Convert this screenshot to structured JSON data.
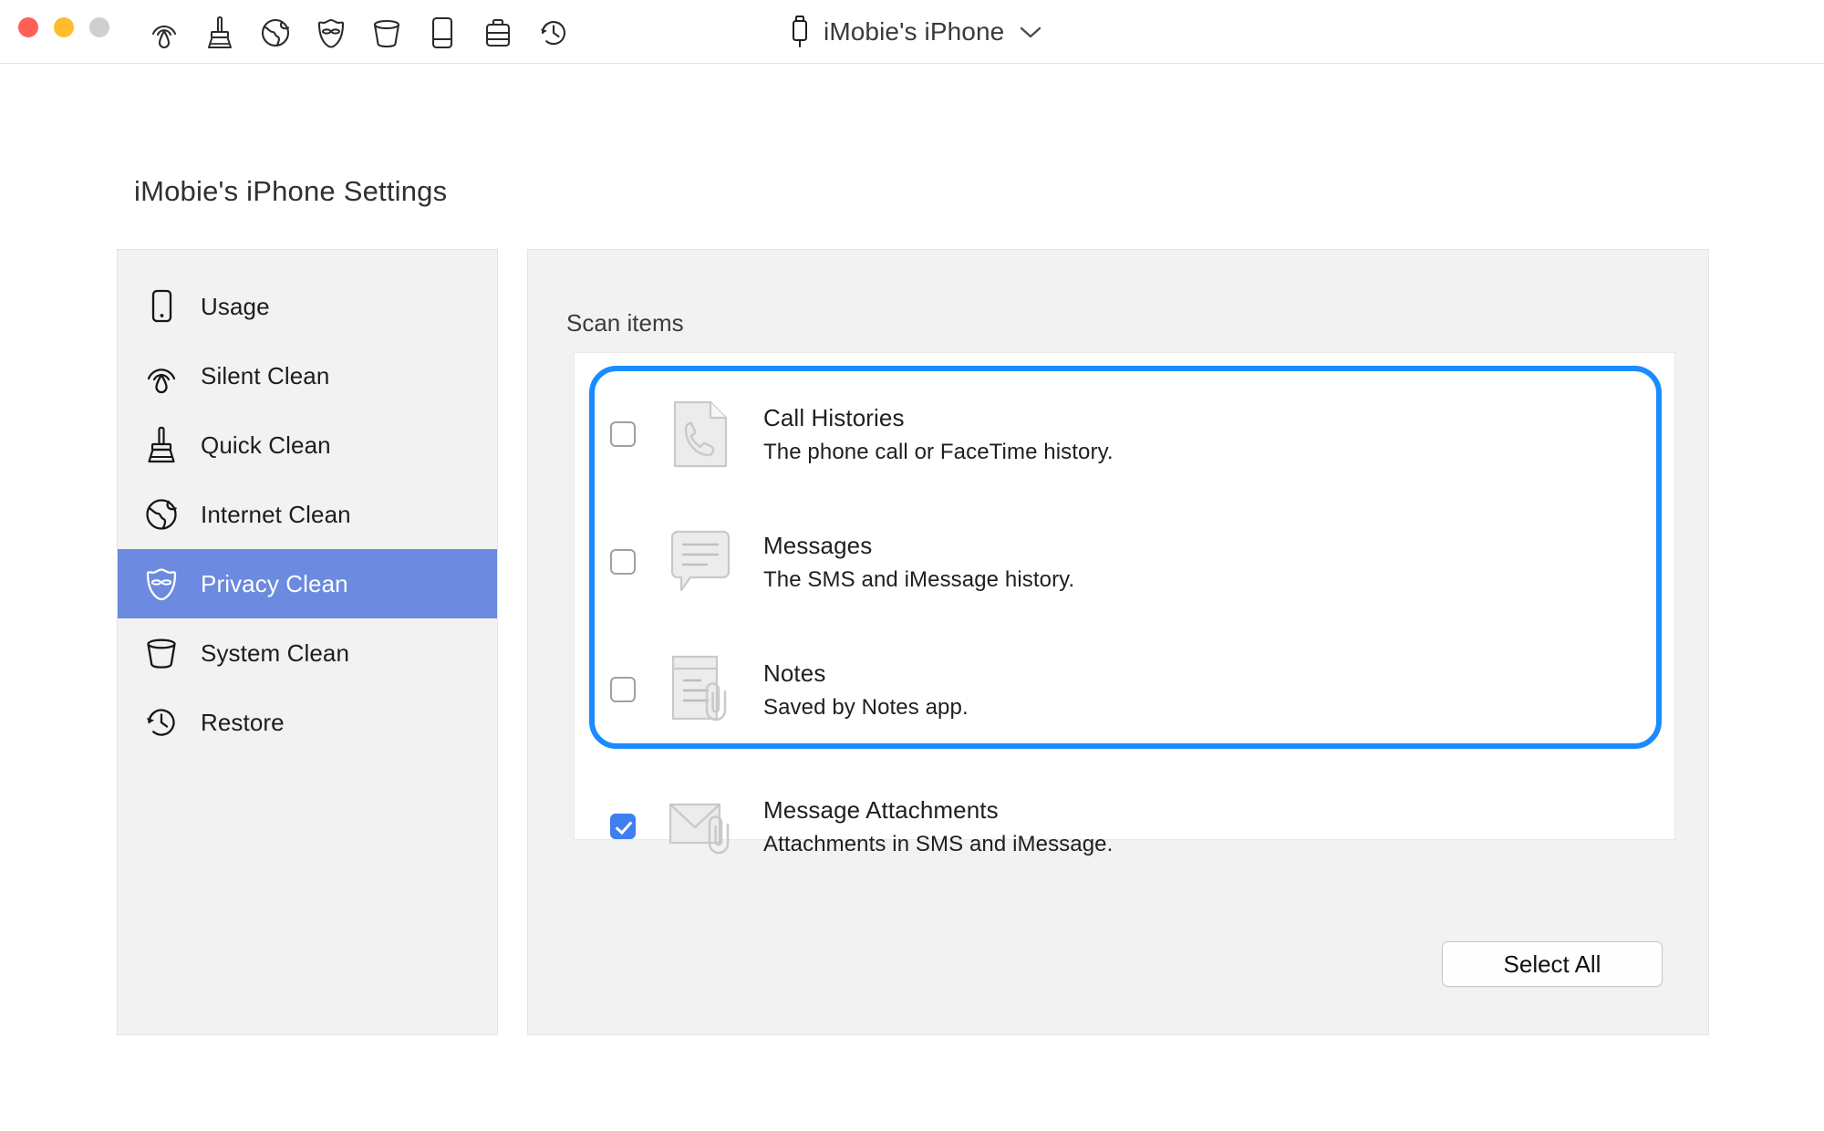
{
  "window": {
    "traffic_lights": [
      {
        "name": "close",
        "color": "#ff5f57"
      },
      {
        "name": "minimize",
        "color": "#febc2e"
      },
      {
        "name": "zoom",
        "color": "#cfcfcf"
      }
    ],
    "toolbar_icons": [
      "silent-clean-icon",
      "quick-clean-icon",
      "internet-clean-icon",
      "privacy-clean-icon",
      "system-clean-icon",
      "usage-icon",
      "toolbox-icon",
      "restore-icon"
    ],
    "device_name": "iMobie's iPhone",
    "device_chevron": "chevron-down-icon"
  },
  "page": {
    "title": "iMobie's iPhone Settings"
  },
  "sidebar": {
    "items": [
      {
        "label": "Usage",
        "icon": "phone-outline-icon",
        "active": false
      },
      {
        "label": "Silent Clean",
        "icon": "silent-clean-icon",
        "active": false
      },
      {
        "label": "Quick Clean",
        "icon": "quick-clean-icon",
        "active": false
      },
      {
        "label": "Internet Clean",
        "icon": "globe-icon",
        "active": false
      },
      {
        "label": "Privacy Clean",
        "icon": "mask-icon",
        "active": true
      },
      {
        "label": "System Clean",
        "icon": "trash-bin-icon",
        "active": false
      },
      {
        "label": "Restore",
        "icon": "clock-restore-icon",
        "active": false
      }
    ],
    "active_color": "#6b8ae0"
  },
  "main": {
    "section_title": "Scan items",
    "focus_ring_color": "#1a8cff",
    "checkbox_checked_color": "#3d7ef0",
    "rows": [
      {
        "title": "Call Histories",
        "description": "The phone call or FaceTime history.",
        "icon": "call-history-document-icon",
        "checked": false,
        "focused": true
      },
      {
        "title": "Messages",
        "description": "The SMS and iMessage history.",
        "icon": "message-bubble-icon",
        "checked": false,
        "focused": true
      },
      {
        "title": "Notes",
        "description": "Saved by Notes app.",
        "icon": "notes-paperclip-icon",
        "checked": false,
        "focused": true
      },
      {
        "title": "Message Attachments",
        "description": "Attachments in SMS and iMessage.",
        "icon": "envelope-paperclip-icon",
        "checked": true,
        "focused": false
      }
    ],
    "select_all_label": "Select All"
  }
}
